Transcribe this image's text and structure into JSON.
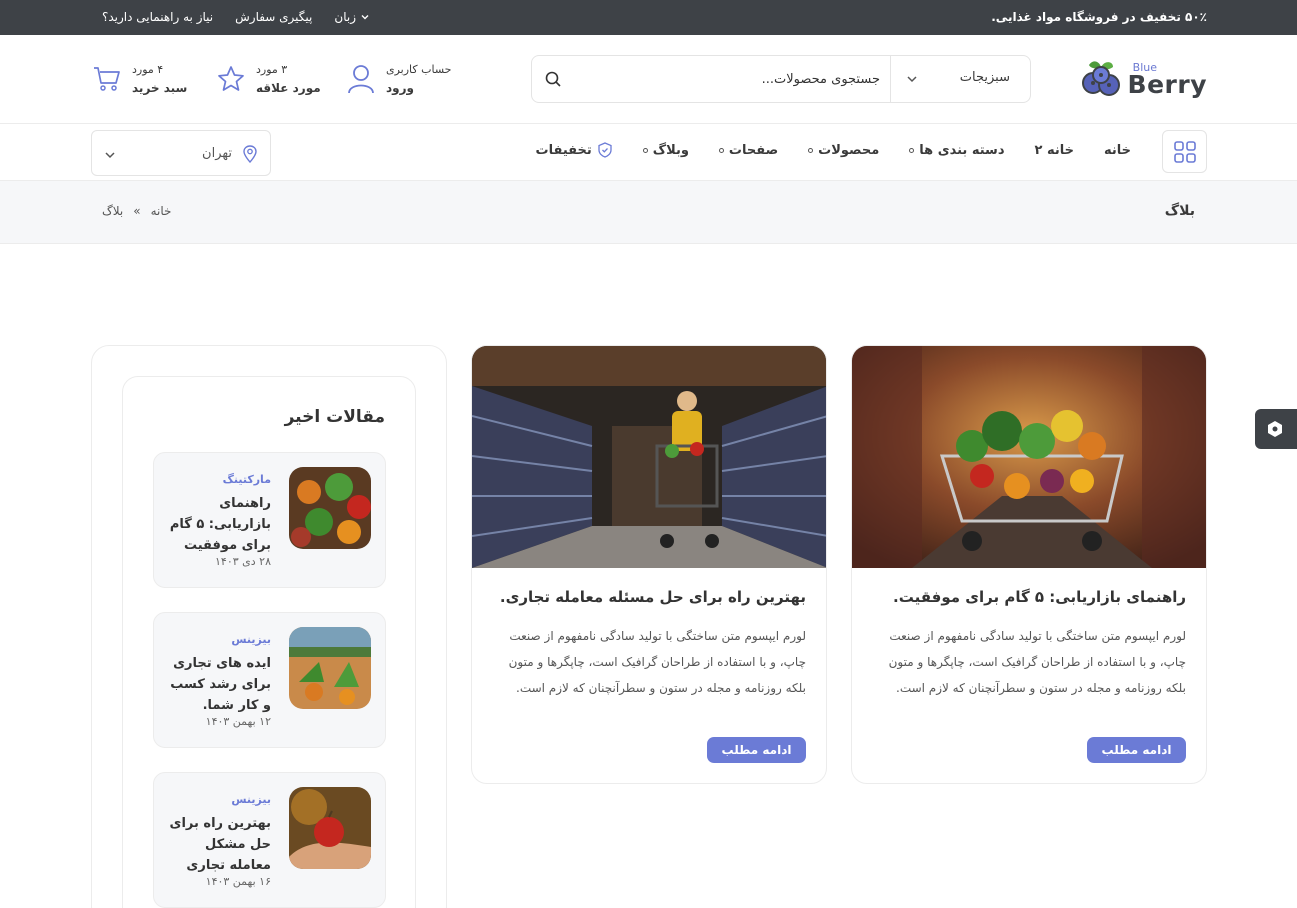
{
  "topbar": {
    "promo": "۵۰٪ تخفیف در فروشگاه مواد غذایی.",
    "help": "نیاز به راهنمایی دارید؟",
    "track": "پیگیری سفارش",
    "language": "زبان"
  },
  "logo": {
    "blue": "Blue",
    "berry": "Berry"
  },
  "search": {
    "category": "سبزیجات",
    "placeholder": "جستجوی محصولات..."
  },
  "account": {
    "top": "حساب کاربری",
    "bottom": "ورود"
  },
  "wishlist": {
    "top": "۳ مورد",
    "bottom": "مورد علاقه"
  },
  "cart": {
    "top": "۴ مورد",
    "bottom": "سبد خرید"
  },
  "nav": {
    "items": [
      "خانه",
      "خانه ۲",
      "دسته بندی ها",
      "محصولات",
      "صفحات",
      "وبلاگ",
      "تخفیفات"
    ]
  },
  "location": {
    "city": "تهران"
  },
  "breadcrumb": {
    "page_title": "بلاگ",
    "home": "خانه",
    "separator": "»",
    "current": "بلاگ"
  },
  "posts": [
    {
      "title": "راهنمای بازاریابی: ۵ گام برای موفقیت.",
      "excerpt": "لورم ایپسوم متن ساختگی با تولید سادگی نامفهوم از صنعت چاپ، و با استفاده از طراحان گرافیک است، چاپگرها و متون بلکه روزنامه و مجله در ستون و سطرآنچنان که لازم است.",
      "more": "ادامه مطلب"
    },
    {
      "title": "بهترین راه برای حل مسئله معامله تجاری.",
      "excerpt": "لورم ایپسوم متن ساختگی با تولید سادگی نامفهوم از صنعت چاپ، و با استفاده از طراحان گرافیک است، چاپگرها و متون بلکه روزنامه و مجله در ستون و سطرآنچنان که لازم است.",
      "more": "ادامه مطلب"
    }
  ],
  "sidebar": {
    "title": "مقالات اخیر",
    "recent": [
      {
        "category": "مارکتینگ",
        "title": "راهنمای بازاریابی: ۵ گام برای موفقیت",
        "date": "۲۸ دی ۱۴۰۳"
      },
      {
        "category": "بیزینس",
        "title": "ایده های تجاری برای رشد کسب و کار شما.",
        "date": "۱۲ بهمن ۱۴۰۳"
      },
      {
        "category": "بیزینس",
        "title": "بهترین راه برای حل مشکل معامله تجاری",
        "date": "۱۶ بهمن ۱۴۰۳"
      }
    ]
  },
  "colors": {
    "accent": "#6b7bd6",
    "dark": "#3e4247",
    "panel": "#f6f7f9"
  }
}
